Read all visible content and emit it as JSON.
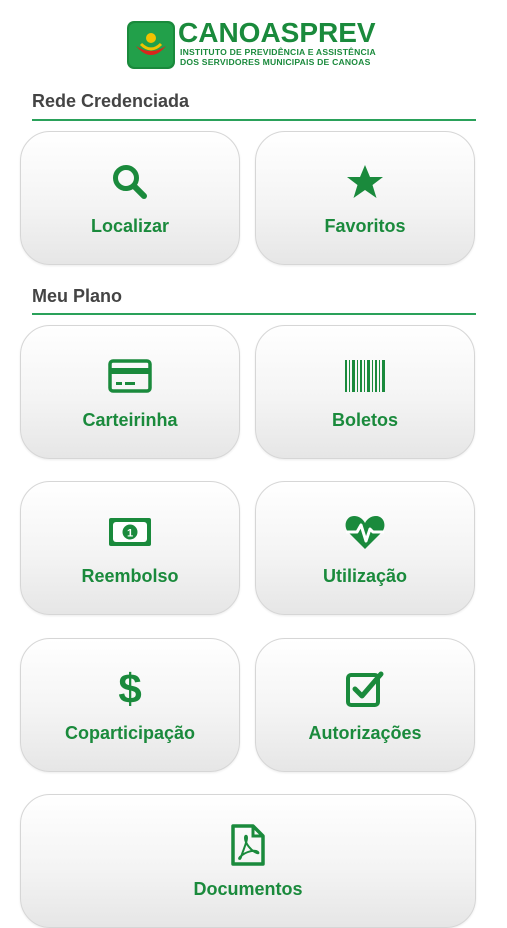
{
  "header": {
    "brand": "CANOASPREV",
    "subtitle_line1": "INSTITUTO DE PREVIDÊNCIA E ASSISTÊNCIA",
    "subtitle_line2": "DOS SERVIDORES MUNICIPAIS DE CANOAS"
  },
  "sections": {
    "rede": {
      "title": "Rede Credenciada"
    },
    "plano": {
      "title": "Meu Plano"
    }
  },
  "tiles": {
    "localizar": {
      "label": "Localizar",
      "icon": "search-icon"
    },
    "favoritos": {
      "label": "Favoritos",
      "icon": "star-icon"
    },
    "carteirinha": {
      "label": "Carteirinha",
      "icon": "credit-card-icon"
    },
    "boletos": {
      "label": "Boletos",
      "icon": "barcode-icon"
    },
    "reembolso": {
      "label": "Reembolso",
      "icon": "money-bill-icon"
    },
    "utilizacao": {
      "label": "Utilização",
      "icon": "heartbeat-icon"
    },
    "coparticipacao": {
      "label": "Coparticipação",
      "icon": "dollar-icon"
    },
    "autorizacoes": {
      "label": "Autorizações",
      "icon": "checkbox-icon"
    },
    "documentos": {
      "label": "Documentos",
      "icon": "pdf-file-icon"
    }
  },
  "colors": {
    "accent": "#1a8a3c",
    "rule": "#2aa15a",
    "section_text": "#444444",
    "logo_red": "#d9261c",
    "logo_yellow": "#f2c200"
  }
}
